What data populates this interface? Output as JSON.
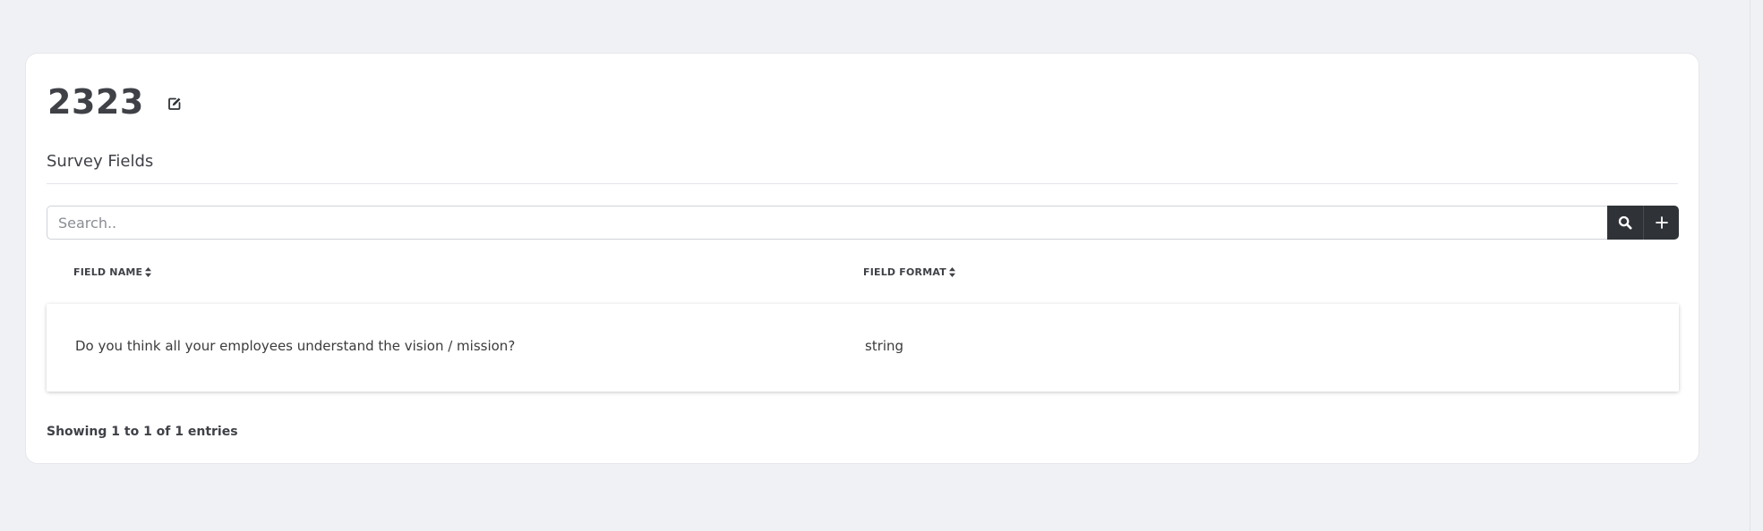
{
  "page": {
    "title": "2323",
    "section_title": "Survey Fields"
  },
  "search": {
    "placeholder": "Search..",
    "value": ""
  },
  "table": {
    "columns": [
      {
        "label": "FIELD NAME"
      },
      {
        "label": "FIELD FORMAT"
      }
    ],
    "rows": [
      {
        "field_name": "Do you think all your employees understand the vision / mission?",
        "field_format": "string"
      }
    ]
  },
  "footer": {
    "info": "Showing 1 to 1 of 1 entries"
  },
  "icons": {
    "edit": "edit-icon",
    "search": "search-icon",
    "add": "plus-icon",
    "sort": "sort-icon"
  },
  "colors": {
    "background": "#f0f1f5",
    "card": "#ffffff",
    "button_dark": "#2f3338"
  }
}
